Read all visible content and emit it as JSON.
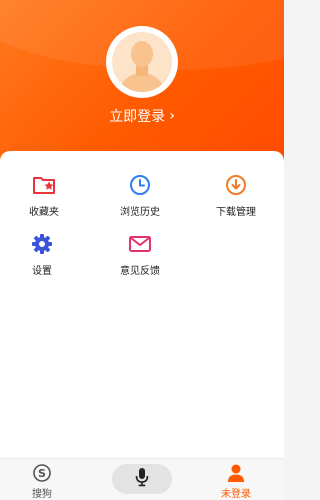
{
  "header": {
    "login_label": "立即登录",
    "login_chevron": "›",
    "avatar_icon": "default-avatar-icon"
  },
  "menu": {
    "items": [
      {
        "label": "收藏夹",
        "icon": "favorites-folder-icon",
        "color": "#e8343a"
      },
      {
        "label": "浏览历史",
        "icon": "clock-icon",
        "color": "#2f7bf0"
      },
      {
        "label": "下载管理",
        "icon": "download-icon",
        "color": "#f07a27"
      },
      {
        "label": "设置",
        "icon": "gear-icon",
        "color": "#3a55d9"
      },
      {
        "label": "意见反馈",
        "icon": "mail-icon",
        "color": "#e3336f"
      }
    ]
  },
  "tabbar": {
    "search_label": "搜狗",
    "mic_icon": "microphone-icon",
    "profile_label": "未登录",
    "active_color": "#ff5a00",
    "inactive_color": "#555555"
  }
}
